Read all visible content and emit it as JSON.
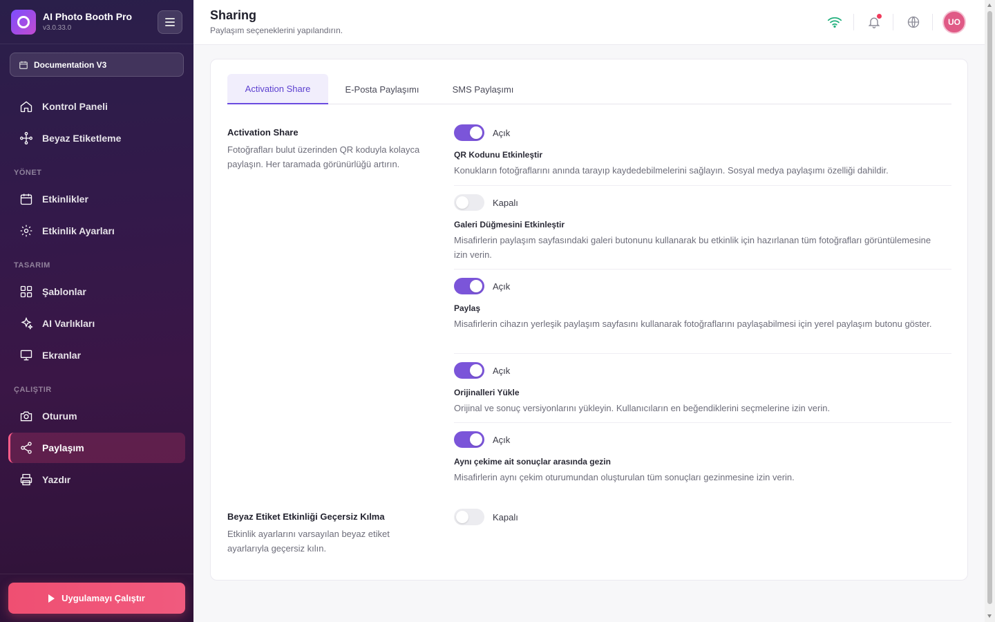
{
  "app": {
    "name": "AI Photo Booth Pro",
    "version": "v3.0.33.0"
  },
  "workspace": {
    "label": "Documentation V3"
  },
  "nav": {
    "dashboard": "Kontrol Paneli",
    "white_label": "Beyaz Etiketleme",
    "section_manage": "YÖNET",
    "events": "Etkinlikler",
    "event_settings": "Etkinlik Ayarları",
    "section_design": "TASARIM",
    "templates": "Şablonlar",
    "ai_assets": "AI Varlıkları",
    "screens": "Ekranlar",
    "section_run": "ÇALIŞTIR",
    "session": "Oturum",
    "sharing": "Paylaşım",
    "print": "Yazdır"
  },
  "run_button": "Uygulamayı Çalıştır",
  "header": {
    "title": "Sharing",
    "subtitle": "Paylaşım seçeneklerini yapılandırın.",
    "avatar_initials": "UO",
    "icons": [
      "wifi-icon",
      "bell-icon",
      "globe-icon"
    ]
  },
  "tabs": [
    "Activation Share",
    "E-Posta Paylaşımı",
    "SMS Paylaşımı"
  ],
  "activation_share": {
    "title": "Activation Share",
    "description": "Fotoğrafları bulut üzerinden QR koduyla kolayca paylaşın. Her taramada görünürlüğü artırın.",
    "options": [
      {
        "state": "Açık",
        "enabled": true,
        "title": "QR Kodunu Etkinleştir",
        "description": "Konukların fotoğraflarını anında tarayıp kaydedebilmelerini sağlayın. Sosyal medya paylaşımı özelliği dahildir."
      },
      {
        "state": "Kapalı",
        "enabled": false,
        "title": "Galeri Düğmesini Etkinleştir",
        "description": "Misafirlerin paylaşım sayfasındaki galeri butonunu kullanarak bu etkinlik için hazırlanan tüm fotoğrafları görüntülemesine izin verin."
      },
      {
        "state": "Açık",
        "enabled": true,
        "title": "Paylaş",
        "description": "Misafirlerin cihazın yerleşik paylaşım sayfasını kullanarak fotoğraflarını paylaşabilmesi için yerel paylaşım butonu göster."
      },
      {
        "state": "Açık",
        "enabled": true,
        "title": "Orijinalleri Yükle",
        "description": "Orijinal ve sonuç versiyonlarını yükleyin. Kullanıcıların en beğendiklerini seçmelerine izin verin."
      },
      {
        "state": "Açık",
        "enabled": true,
        "title": "Aynı çekime ait sonuçlar arasında gezin",
        "description": "Misafirlerin aynı çekim oturumundan oluşturulan tüm sonuçları gezinmesine izin verin."
      }
    ]
  },
  "white_label_override": {
    "title": "Beyaz Etiket Etkinliği Geçersiz Kılma",
    "description": "Etkinlik ayarlarını varsayılan beyaz etiket ayarlarıyla geçersiz kılın.",
    "state": "Kapalı",
    "enabled": false
  },
  "colors": {
    "accent": "#7b55d9",
    "run_button": "#ef4f72",
    "wifi": "#22b07d"
  }
}
